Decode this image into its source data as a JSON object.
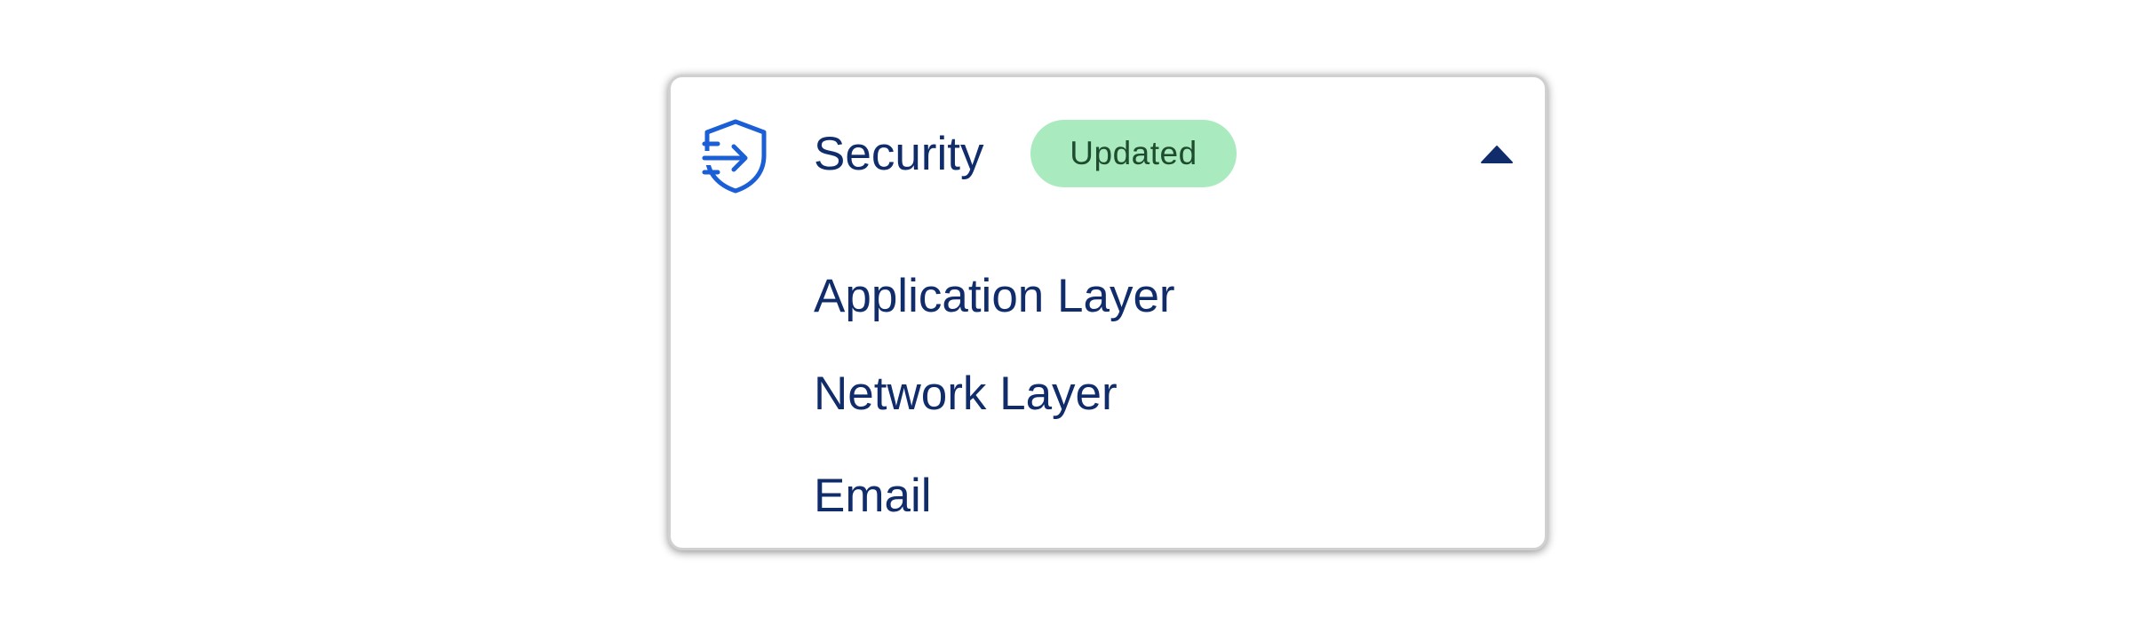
{
  "section": {
    "title": "Security",
    "badge": "Updated",
    "icon": "shield-arrow-icon",
    "toggle_icon": "caret-up-icon",
    "expanded": true
  },
  "items": [
    {
      "label": "Application Layer"
    },
    {
      "label": "Network Layer"
    },
    {
      "label": "Email"
    }
  ],
  "colors": {
    "text": "#102c6b",
    "icon_accent": "#1a5fd6",
    "badge_bg": "#aaeabf",
    "badge_text": "#1d4d2e",
    "card_border": "#d0d0d0"
  }
}
